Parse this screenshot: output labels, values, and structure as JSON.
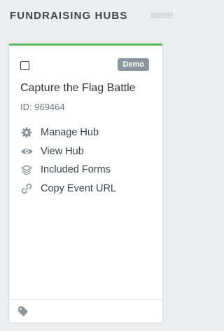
{
  "section": {
    "title": "FUNDRAISING HUBS"
  },
  "card": {
    "badge": "Demo",
    "title": "Capture the Flag Battle",
    "id_text": "ID: 969464",
    "actions": [
      {
        "label": "Manage Hub",
        "icon": "gear-icon"
      },
      {
        "label": "View Hub",
        "icon": "eye-icon"
      },
      {
        "label": "Included Forms",
        "icon": "layers-icon"
      },
      {
        "label": "Copy Event URL",
        "icon": "link-icon"
      }
    ],
    "footer_icon": "tag-icon"
  },
  "colors": {
    "accent_top_border": "#5cb85c",
    "badge_bg": "#8e979d",
    "page_bg": "#ebedef",
    "icon": "#8c959c"
  }
}
